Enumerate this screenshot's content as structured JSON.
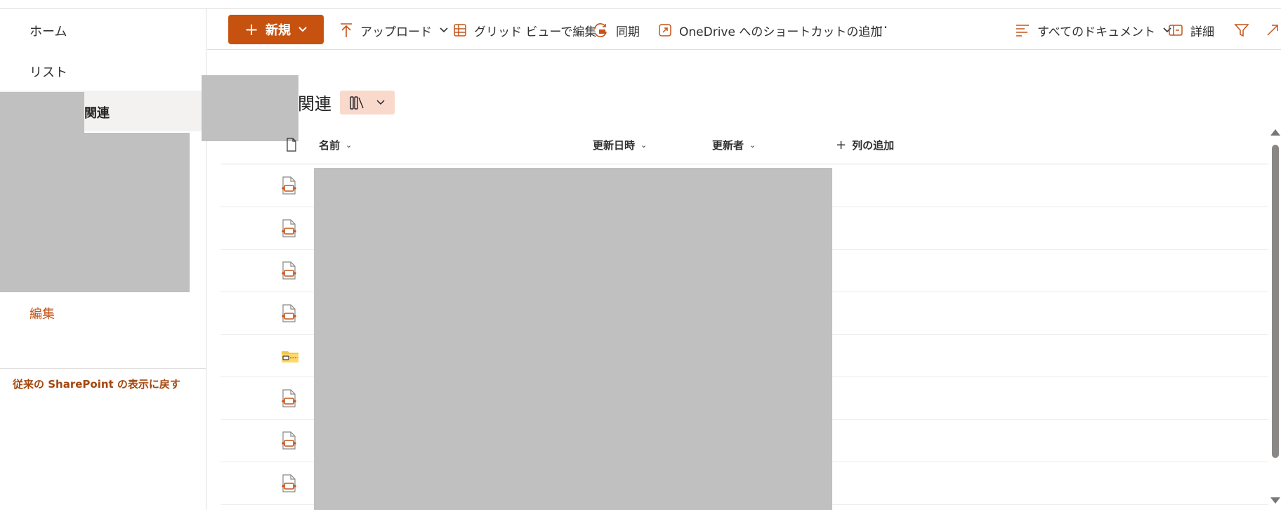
{
  "nav": {
    "home": "ホーム",
    "list": "リスト",
    "related": "関連",
    "edit": "編集",
    "classic": "従来の SharePoint の表示に戻す"
  },
  "commands": {
    "new": "新規",
    "upload": "アップロード",
    "grid_edit": "グリッド ビューで編集",
    "sync": "同期",
    "onedrive_shortcut": "OneDrive へのショートカットの追加",
    "more": "···",
    "all_documents": "すべてのドキュメント",
    "details": "詳細"
  },
  "library": {
    "title": "関連"
  },
  "columns": {
    "name": "名前",
    "modified": "更新日時",
    "modified_by": "更新者",
    "add_column": "列の追加"
  },
  "rows": [
    {
      "type": "file"
    },
    {
      "type": "file"
    },
    {
      "type": "file"
    },
    {
      "type": "file"
    },
    {
      "type": "zip-folder"
    },
    {
      "type": "file"
    },
    {
      "type": "file"
    },
    {
      "type": "file"
    }
  ],
  "colors": {
    "accent": "#c7510f",
    "accent_light": "#f8d9cc",
    "nav_link": "#c4531a"
  }
}
